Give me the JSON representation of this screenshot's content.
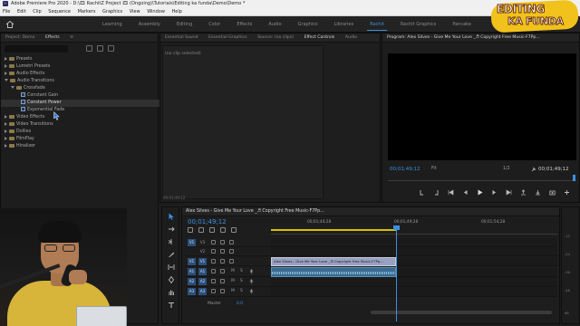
{
  "window": {
    "title": "Adobe Premiere Pro 2020 - D:\\🎞 RachitZ Project 🎞 (Ongoing)\\Tutorials\\Editing ka funda\\Demo\\Demo *",
    "app_icon": "Pr"
  },
  "menu": [
    "File",
    "Edit",
    "Clip",
    "Sequence",
    "Markers",
    "Graphics",
    "View",
    "Window",
    "Help"
  ],
  "workspaces": [
    "Learning",
    "Assembly",
    "Editing",
    "Color",
    "Effects",
    "Audio",
    "Graphics",
    "Libraries",
    "Rachit",
    "Rachit Graphics",
    "Pancake"
  ],
  "active_workspace": "Rachit",
  "logo": {
    "line1": "EDITING",
    "line2": "KA FUNDA"
  },
  "effects_panel": {
    "tabs": [
      "Project: Demo",
      "Effects"
    ],
    "active_tab": "Effects",
    "tree": [
      {
        "label": "Presets",
        "kind": "folder",
        "level": 0,
        "open": false
      },
      {
        "label": "Lumetri Presets",
        "kind": "folder",
        "level": 0,
        "open": false
      },
      {
        "label": "Audio Effects",
        "kind": "folder",
        "level": 0,
        "open": false
      },
      {
        "label": "Audio Transitions",
        "kind": "folder",
        "level": 0,
        "open": true
      },
      {
        "label": "Crossfade",
        "kind": "folder",
        "level": 1,
        "open": true
      },
      {
        "label": "Constant Gain",
        "kind": "effect",
        "level": 2
      },
      {
        "label": "Constant Power",
        "kind": "effect",
        "level": 2,
        "selected": true
      },
      {
        "label": "Exponential Fade",
        "kind": "effect",
        "level": 2
      },
      {
        "label": "Video Effects",
        "kind": "folder",
        "level": 0,
        "open": false
      },
      {
        "label": "Video Transitions",
        "kind": "folder",
        "level": 0,
        "open": false
      },
      {
        "label": "Dollies",
        "kind": "folder",
        "level": 0,
        "open": false
      },
      {
        "label": "FilmPlay",
        "kind": "folder",
        "level": 0,
        "open": false
      },
      {
        "label": "Hinalizer",
        "kind": "folder",
        "level": 0,
        "open": false
      }
    ]
  },
  "source_panel": {
    "tabs": [
      "Essential Sound",
      "Essential Graphics",
      "Source: (no clips)",
      "Effect Controls",
      "Audio"
    ],
    "active_tab": "Effect Controls",
    "empty_text": "(no clip selected)",
    "footer_timecode": "00;01;49;12"
  },
  "program_panel": {
    "tab": "Program: Alex Silves - Give Me Your Love _♬ Copyright Free Music-F7Pp...",
    "timecode": "00;01;49;12",
    "fit": "Fit",
    "ratio": "1/2",
    "duration": "00;01;49;12",
    "controls": [
      "mark-in",
      "mark-out",
      "go-to-in",
      "step-back",
      "play",
      "step-forward",
      "go-to-out",
      "lift",
      "extract",
      "export-frame",
      "button-editor"
    ]
  },
  "tools": [
    "selection",
    "track-select",
    "ripple-edit",
    "razor",
    "slip",
    "pen",
    "hand",
    "type"
  ],
  "timeline": {
    "sequence_name": "Alex Silves - Give Me Your Love _♬ Copyright Free Music-F7Pp...",
    "timecode": "00;01;49;12",
    "ruler_labels": [
      "00;01;44;28",
      "00;01;49;28",
      "00;01;54;28"
    ],
    "tracks": [
      {
        "src": "V1",
        "name": "V3",
        "kind": "video"
      },
      {
        "src": "",
        "name": "V2",
        "kind": "video"
      },
      {
        "src": "V1",
        "name": "V1",
        "kind": "video"
      },
      {
        "src": "A1",
        "name": "A1",
        "kind": "audio"
      },
      {
        "src": "A2",
        "name": "A2",
        "kind": "audio"
      },
      {
        "src": "A3",
        "name": "A3",
        "kind": "audio"
      }
    ],
    "clip_video_label": "Alex Silves - Give Me Your Love _♬ Copyright Free Music-F7Pp...",
    "master_label": "Master",
    "master_value": "0.0"
  },
  "meter": {
    "labels": [
      "-12",
      "-24",
      "-36",
      "-48",
      "dB"
    ]
  },
  "colors": {
    "accent": "#3d8fe0",
    "panel_bg": "#1d1d1d",
    "video_clip": "#9aa0c0",
    "audio_clip": "#3a6b8f",
    "logo_yellow": "#f1c21b"
  }
}
